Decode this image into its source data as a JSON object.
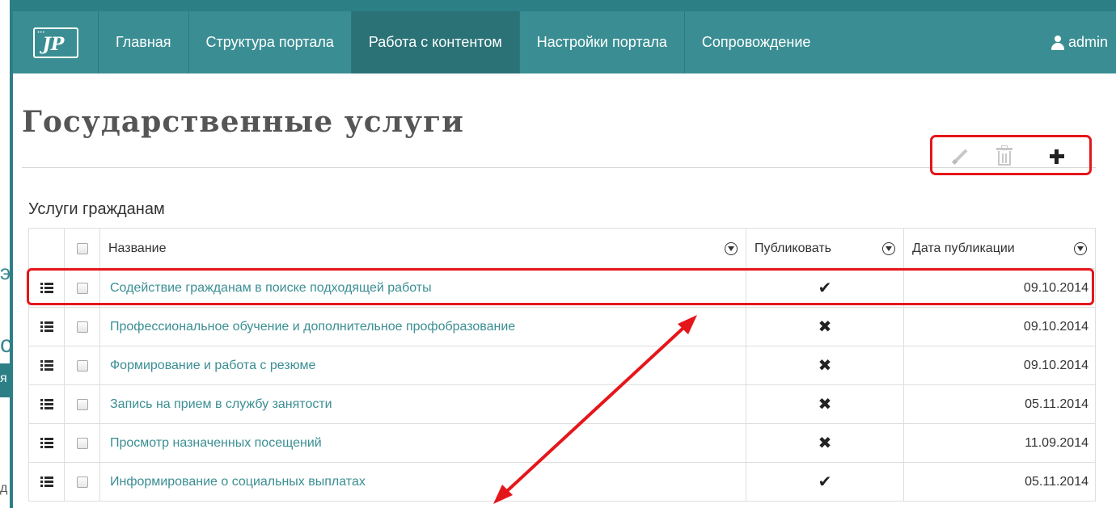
{
  "nav": {
    "items": [
      {
        "label": "Главная",
        "active": false
      },
      {
        "label": "Структура портала",
        "active": false
      },
      {
        "label": "Работа с контентом",
        "active": true
      },
      {
        "label": "Настройки портала",
        "active": false
      },
      {
        "label": "Сопровождение",
        "active": false
      }
    ],
    "user": "admin",
    "logo_icon": "portal-logo-icon"
  },
  "page": {
    "title": "Государственные услуги",
    "section_title": "Услуги гражданам"
  },
  "toolbar": {
    "icons": [
      "pencil-icon",
      "trash-icon",
      "plus-icon"
    ]
  },
  "table": {
    "columns": {
      "name": "Название",
      "publish": "Публиковать",
      "date": "Дата публикации"
    },
    "rows": [
      {
        "name": "Содействие гражданам в поиске подходящей работы",
        "publish": "✔",
        "date": "09.10.2014"
      },
      {
        "name": "Профессиональное обучение и дополнительное профобразование",
        "publish": "✖",
        "date": "09.10.2014"
      },
      {
        "name": "Формирование и работа с резюме",
        "publish": "✖",
        "date": "09.10.2014"
      },
      {
        "name": "Запись на прием в службу занятости",
        "publish": "✖",
        "date": "05.11.2014"
      },
      {
        "name": "Просмотр назначенных посещений",
        "publish": "✖",
        "date": "11.09.2014"
      },
      {
        "name": "Информирование о социальных выплатах",
        "publish": "✔",
        "date": "05.11.2014"
      }
    ]
  },
  "background_fragments": [
    "э",
    "с",
    "я",
    "д"
  ],
  "colors": {
    "navbar": "#3a8e93",
    "navbar_active": "#2b7277",
    "link": "#3a8e93",
    "annotation": "#e5161a",
    "frame": "#2d7f86"
  }
}
